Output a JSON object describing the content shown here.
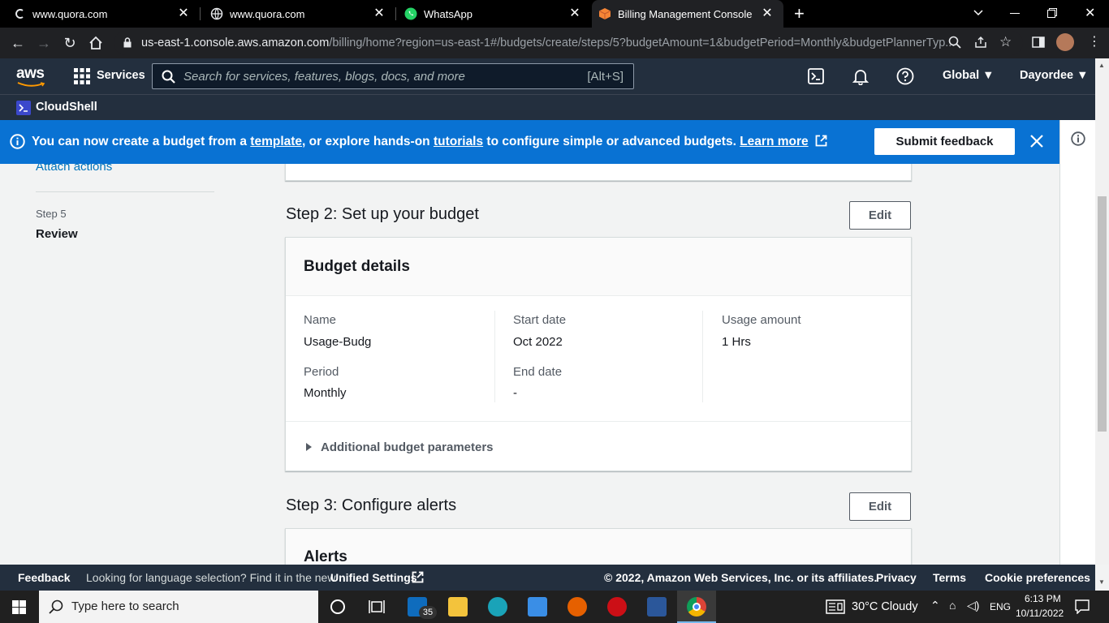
{
  "browser": {
    "tabs": [
      {
        "title": "www.quora.com",
        "icon": "quora-icon"
      },
      {
        "title": "www.quora.com",
        "icon": "globe-icon"
      },
      {
        "title": "WhatsApp",
        "icon": "whatsapp-icon"
      },
      {
        "title": "Billing Management Console",
        "icon": "aws-billing-icon",
        "active": true
      }
    ],
    "url_host": "us-east-1.console.aws.amazon.com",
    "url_path": "/billing/home?region=us-east-1#/budgets/create/steps/5?budgetAmount=1&budgetPeriod=Monthly&budgetPlannerTyp..."
  },
  "aws_header": {
    "logo": "aws",
    "services": "Services",
    "search_placeholder": "Search for services, features, blogs, docs, and more",
    "search_shortcut": "[Alt+S]",
    "region": "Global ▼",
    "account": "Dayordee ▼",
    "cloudshell": "CloudShell"
  },
  "flash": {
    "part1": "You can now create a budget from a ",
    "link_template": "template",
    "part2": ", or explore hands-on ",
    "link_tutorials": "tutorials",
    "part3": " to configure simple or advanced budgets. ",
    "link_learn": "Learn more",
    "feedback_button": "Submit feedback"
  },
  "left_nav": {
    "attach_actions": "Attach actions",
    "step5_label": "Step 5",
    "step5_title": "Review"
  },
  "step2": {
    "heading": "Step 2: Set up your budget",
    "edit": "Edit",
    "card_title": "Budget details",
    "fields": {
      "name_label": "Name",
      "name_value": "Usage-Budg",
      "start_label": "Start date",
      "start_value": "Oct 2022",
      "usage_label": "Usage amount",
      "usage_value": "1 Hrs",
      "period_label": "Period",
      "period_value": "Monthly",
      "end_label": "End date",
      "end_value": "-"
    },
    "expander": "Additional budget parameters"
  },
  "step3": {
    "heading": "Step 3: Configure alerts",
    "edit": "Edit",
    "card_title": "Alerts"
  },
  "footer": {
    "feedback": "Feedback",
    "lang_text": "Looking for language selection? Find it in the new",
    "unified": "Unified Settings",
    "copyright": "© 2022, Amazon Web Services, Inc. or its affiliates.",
    "privacy": "Privacy",
    "terms": "Terms",
    "cookies": "Cookie preferences"
  },
  "taskbar": {
    "search_placeholder": "Type here to search",
    "mail_badge": "35",
    "weather": "30°C  Cloudy",
    "lang": "ENG",
    "time": "6:13 PM",
    "date": "10/11/2022"
  }
}
